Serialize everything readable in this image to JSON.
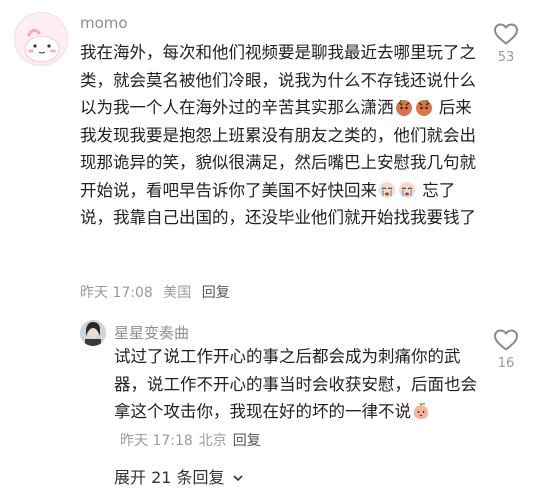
{
  "main_comment": {
    "username": "momo",
    "text_1": "我在海外，每次和他们视频要是聊我最近去哪里玩了之类，就会莫名被他们冷眼，说我为什么不存钱还说什么以为我一个人在海外过的辛苦其实那么潇洒",
    "text_2": " 后来我发现我要是抱怨上班累没有朋友之类的，他们就会出现那诡异的笑，貌似很满足，然后嘴巴上安慰我几句就开始说，看吧早告诉你了美国不好快回来",
    "text_3": " 忘了说，我靠自己出国的，还没毕业他们就开始找我要钱了",
    "time": "昨天 17:08",
    "location": "美国",
    "reply_label": "回复",
    "likes": "53",
    "icons": [
      "angry-sticker-icon",
      "crying-sticker-icon"
    ]
  },
  "reply_comment": {
    "username": "星星变奏曲",
    "text": "试过了说工作开心的事之后都会成为刺痛你的武器，说工作不开心的事当时会收获安慰，后面也会拿这个攻击你，我现在好的坏的一律不说",
    "time": "昨天 17:18",
    "location": "北京",
    "reply_label": "回复",
    "likes": "16"
  },
  "expand_replies": "展开 21 条回复"
}
